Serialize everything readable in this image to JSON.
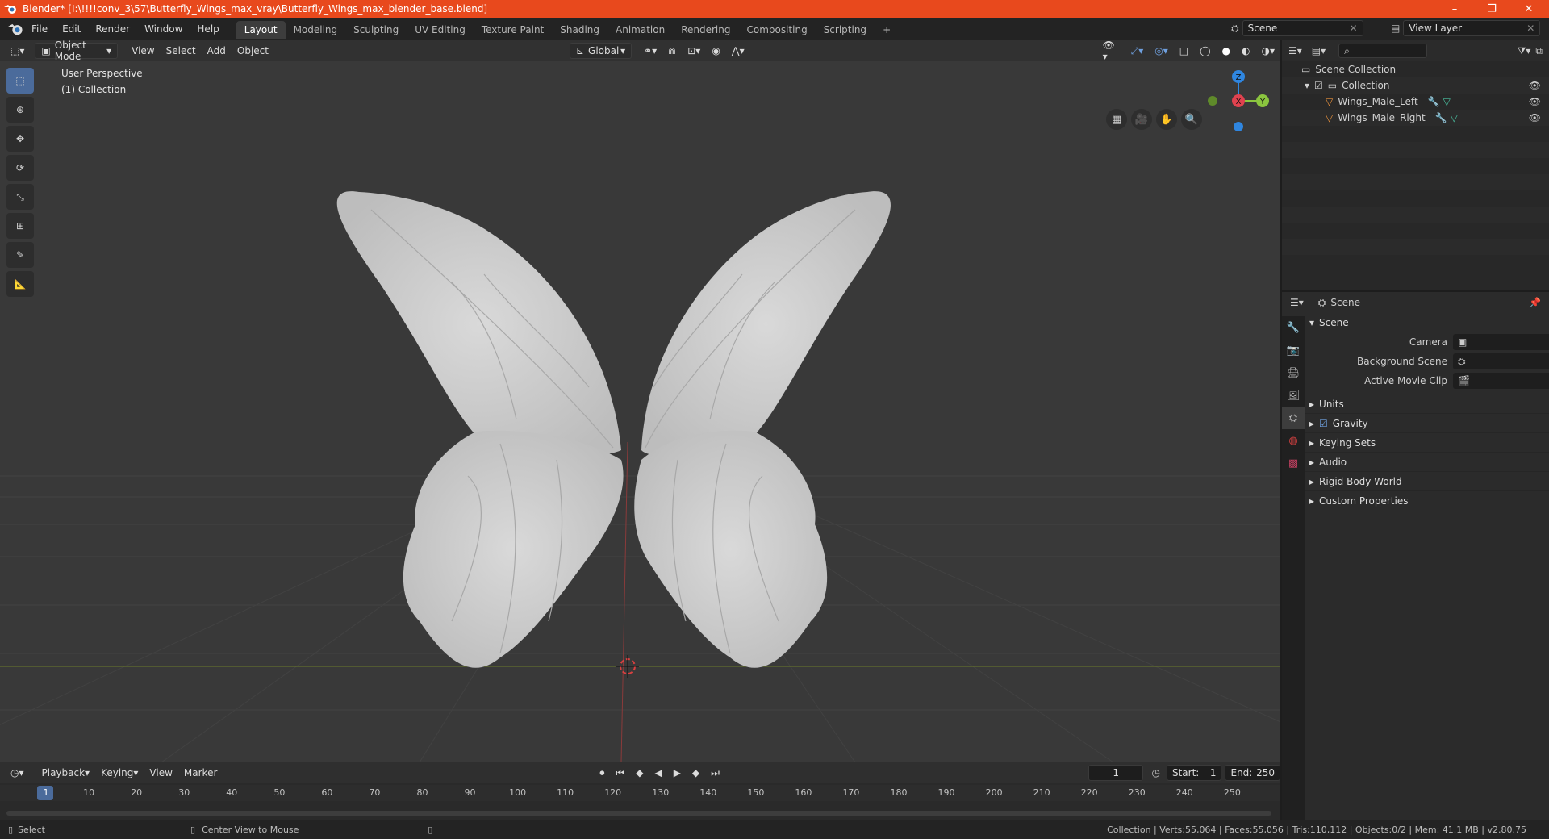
{
  "window": {
    "title": "Blender* [I:\\!!!!conv_3\\57\\Butterfly_Wings_max_vray\\Butterfly_Wings_max_blender_base.blend]",
    "minimize": "–",
    "restore": "❐",
    "close": "✕"
  },
  "menu": [
    "File",
    "Edit",
    "Render",
    "Window",
    "Help"
  ],
  "workspaces": [
    "Layout",
    "Modeling",
    "Sculpting",
    "UV Editing",
    "Texture Paint",
    "Shading",
    "Animation",
    "Rendering",
    "Compositing",
    "Scripting"
  ],
  "add_workspace": "+",
  "scene_field": "Scene",
  "view_layer_field": "View Layer",
  "viewport": {
    "mode": "Object Mode",
    "menus": [
      "View",
      "Select",
      "Add",
      "Object"
    ],
    "orientation": "Global",
    "overlay_title": "User Perspective",
    "overlay_collection": "(1) Collection",
    "gizmo_z": "Z",
    "gizmo_x": "X",
    "gizmo_y": "Y"
  },
  "outliner": {
    "root": "Scene Collection",
    "collection": "Collection",
    "objects": [
      "Wings_Male_Left",
      "Wings_Male_Right"
    ]
  },
  "properties": {
    "header": "Scene",
    "panel_title": "Scene",
    "camera_label": "Camera",
    "background_label": "Background Scene",
    "movie_clip_label": "Active Movie Clip",
    "sections": [
      "Units",
      "Gravity",
      "Keying Sets",
      "Audio",
      "Rigid Body World",
      "Custom Properties"
    ]
  },
  "timeline": {
    "menus": [
      "Playback",
      "Keying",
      "View",
      "Marker"
    ],
    "current_frame": "1",
    "start_label": "Start:",
    "start": "1",
    "end_label": "End:",
    "end": "250",
    "ticks": [
      "1",
      "10",
      "20",
      "30",
      "40",
      "50",
      "60",
      "70",
      "80",
      "90",
      "100",
      "110",
      "120",
      "130",
      "140",
      "150",
      "160",
      "170",
      "180",
      "190",
      "200",
      "210",
      "220",
      "230",
      "240",
      "250"
    ]
  },
  "status": {
    "select": "Select",
    "center": "Center View to Mouse",
    "stats": "Collection | Verts:55,064 | Faces:55,056 | Tris:110,112 | Objects:0/2 | Mem: 41.1 MB | v2.80.75"
  },
  "colors": {
    "titlebar": "#e8491d",
    "accent": "#4b6b9b",
    "x_axis": "#e0424f",
    "y_axis": "#8bc53f",
    "z_axis": "#2f86e0"
  }
}
